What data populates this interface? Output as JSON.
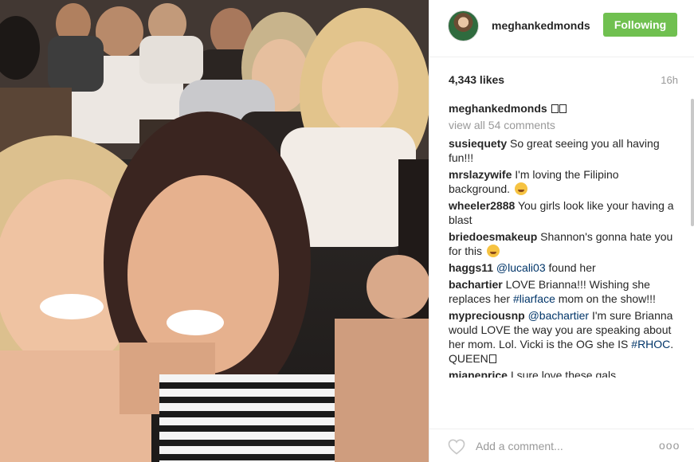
{
  "post": {
    "username": "meghankedmonds",
    "follow_label": "Following",
    "likes": "4,343 likes",
    "time": "16h",
    "caption_user": "meghankedmonds",
    "view_all": "view all 54 comments",
    "comment_placeholder": "Add a comment...",
    "more_label": "ooo"
  },
  "comments": [
    {
      "user": "susiequety",
      "text": "So great seeing you all having fun!!!"
    },
    {
      "user": "mrslazywife",
      "text": "I'm loving the Filipino background."
    },
    {
      "user": "wheeler2888",
      "text": "You girls look like your having a blast"
    },
    {
      "user": "briedoesmakeup",
      "text": "Shannon's gonna hate you for this"
    },
    {
      "user": "haggs11",
      "mention": "@lucali03",
      "text": "found her"
    },
    {
      "user": "bachartier",
      "text": "LOVE Brianna!!! Wishing she replaces her",
      "hashtag": "#liarface",
      "text2": "mom on the show!!!"
    },
    {
      "user": "mypreciousnp",
      "mention": "@bachartier",
      "text": "I'm sure Brianna would LOVE the way you are speaking about her mom. Lol. Vicki is the OG she IS",
      "hashtag": "#RHOC",
      "text2": ". QUEEN"
    },
    {
      "user": "mianeprice",
      "text": "I sure love these gals"
    }
  ],
  "colors": {
    "follow_bg": "#70c050",
    "link": "#003569",
    "muted": "#999999"
  },
  "icons": {
    "like": "heart-outline-icon",
    "more": "ellipsis-icon"
  }
}
